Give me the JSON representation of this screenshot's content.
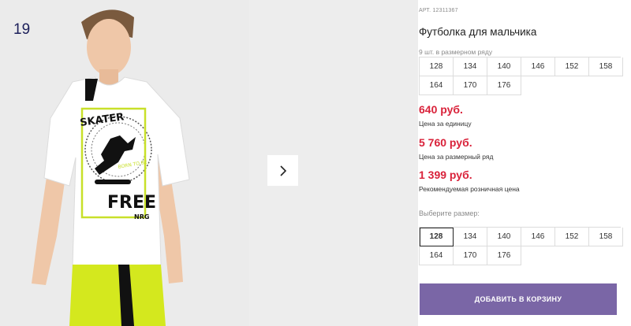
{
  "gallery": {
    "counter": "19",
    "shirt_print": {
      "skater": "SKATER",
      "born": "BORN TO BE",
      "free": "FREE",
      "brand": "NRG"
    },
    "colors": {
      "shirt": "#ffffff",
      "pants": "#d4e81e",
      "background": "#ebebeb"
    },
    "next_icon": "chevron-right-icon"
  },
  "product": {
    "article_label": "АРТ.",
    "article": "12311367",
    "title": "Футболка для мальчика",
    "row_note": "9 шт. в размерном ряду",
    "row_sizes": [
      "128",
      "134",
      "140",
      "146",
      "152",
      "158",
      "164",
      "170",
      "176"
    ],
    "prices": [
      {
        "value": "640 руб.",
        "label": "Цена за единицу"
      },
      {
        "value": "5 760 руб.",
        "label": "Цена за размерный ряд"
      },
      {
        "value": "1 399 руб.",
        "label": "Рекомендуемая розничная цена"
      }
    ],
    "choose_label": "Выберите размер:",
    "pick_sizes": [
      "128",
      "134",
      "140",
      "146",
      "152",
      "158",
      "164",
      "170",
      "176"
    ],
    "selected_size": "128",
    "add_to_cart": "ДОБАВИТЬ В КОРЗИНУ"
  },
  "colors": {
    "price": "#d9223a",
    "button": "#7a66a6"
  }
}
